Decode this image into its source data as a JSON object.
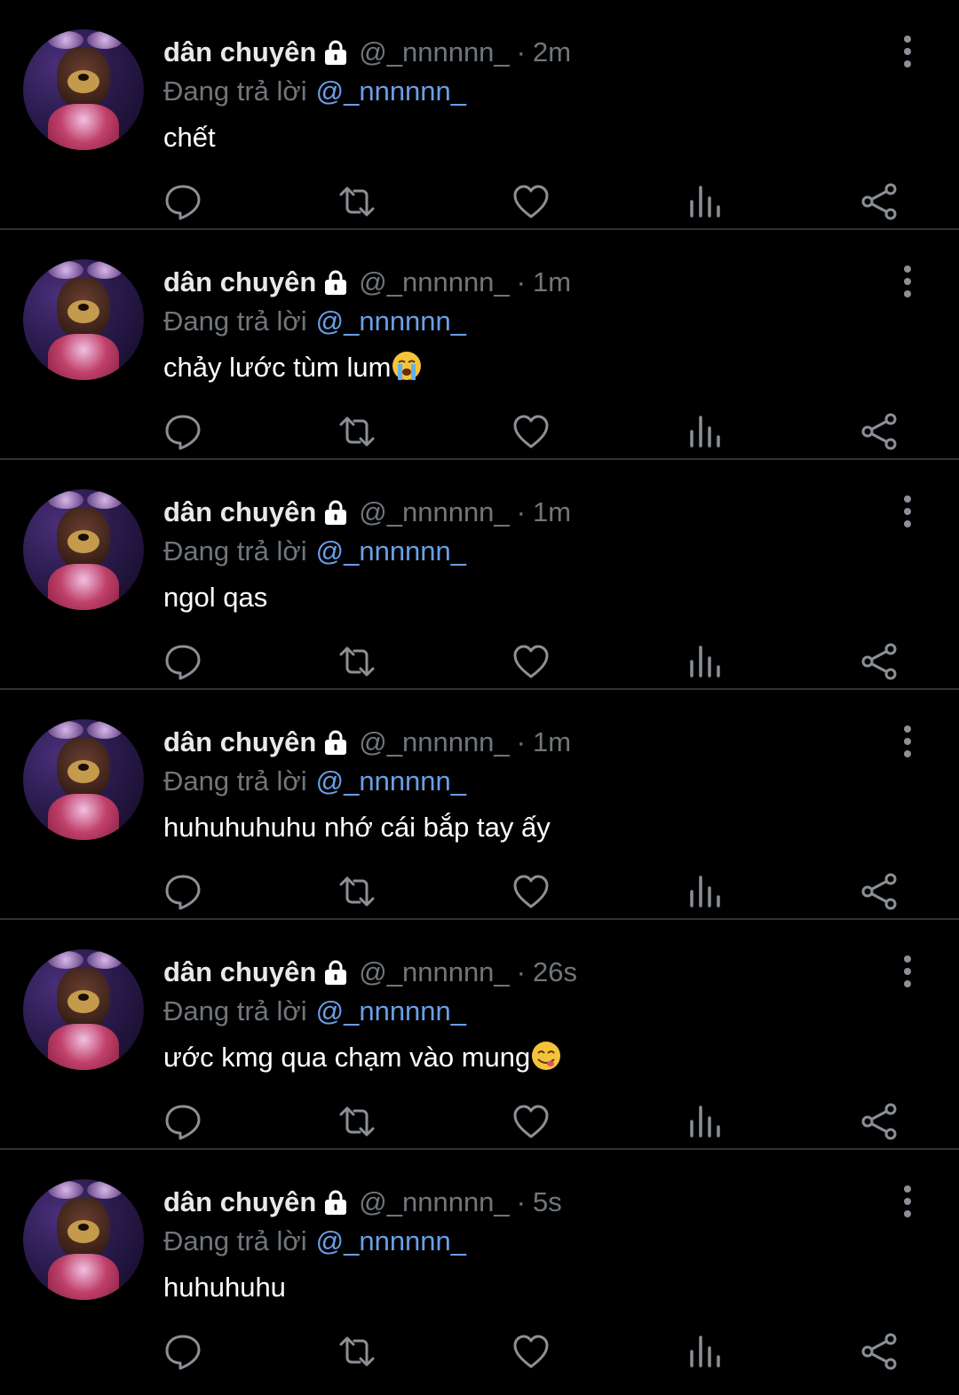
{
  "colors": {
    "background": "#000000",
    "divider": "#2f3336",
    "name": "#e7e9ea",
    "muted": "#71767b",
    "mention": "#6a9fe6",
    "icon": "#8b9096"
  },
  "icons": {
    "lock": "lock-icon",
    "reply": "reply-icon",
    "retweet": "retweet-icon",
    "like": "heart-icon",
    "views": "views-bar-chart-icon",
    "share": "share-icon",
    "more": "more-vertical-icon"
  },
  "tweets": [
    {
      "name": "dân chuyên",
      "handle": "@_nnnnnn_",
      "separator": "·",
      "time": "2m",
      "reply_label": "Đang trả lời",
      "reply_handle": "@_nnnnnn_",
      "text": "chết",
      "emoji": ""
    },
    {
      "name": "dân chuyên",
      "handle": "@_nnnnnn_",
      "separator": "·",
      "time": "1m",
      "reply_label": "Đang trả lời",
      "reply_handle": "@_nnnnnn_",
      "text": "chảy lước tùm lum",
      "emoji": "loudly-crying-face"
    },
    {
      "name": "dân chuyên",
      "handle": "@_nnnnnn_",
      "separator": "·",
      "time": "1m",
      "reply_label": "Đang trả lời",
      "reply_handle": "@_nnnnnn_",
      "text": "ngol qas",
      "emoji": ""
    },
    {
      "name": "dân chuyên",
      "handle": "@_nnnnnn_",
      "separator": "·",
      "time": "1m",
      "reply_label": "Đang trả lời",
      "reply_handle": "@_nnnnnn_",
      "text": "huhuhuhuhu nhớ cái bắp tay ấy",
      "emoji": ""
    },
    {
      "name": "dân chuyên",
      "handle": "@_nnnnnn_",
      "separator": "·",
      "time": "26s",
      "reply_label": "Đang trả lời",
      "reply_handle": "@_nnnnnn_",
      "text": "ước kmg qua chạm vào mung",
      "emoji": "face-savoring-food"
    },
    {
      "name": "dân chuyên",
      "handle": "@_nnnnnn_",
      "separator": "·",
      "time": "5s",
      "reply_label": "Đang trả lời",
      "reply_handle": "@_nnnnnn_",
      "text": "huhuhuhu",
      "emoji": ""
    }
  ]
}
